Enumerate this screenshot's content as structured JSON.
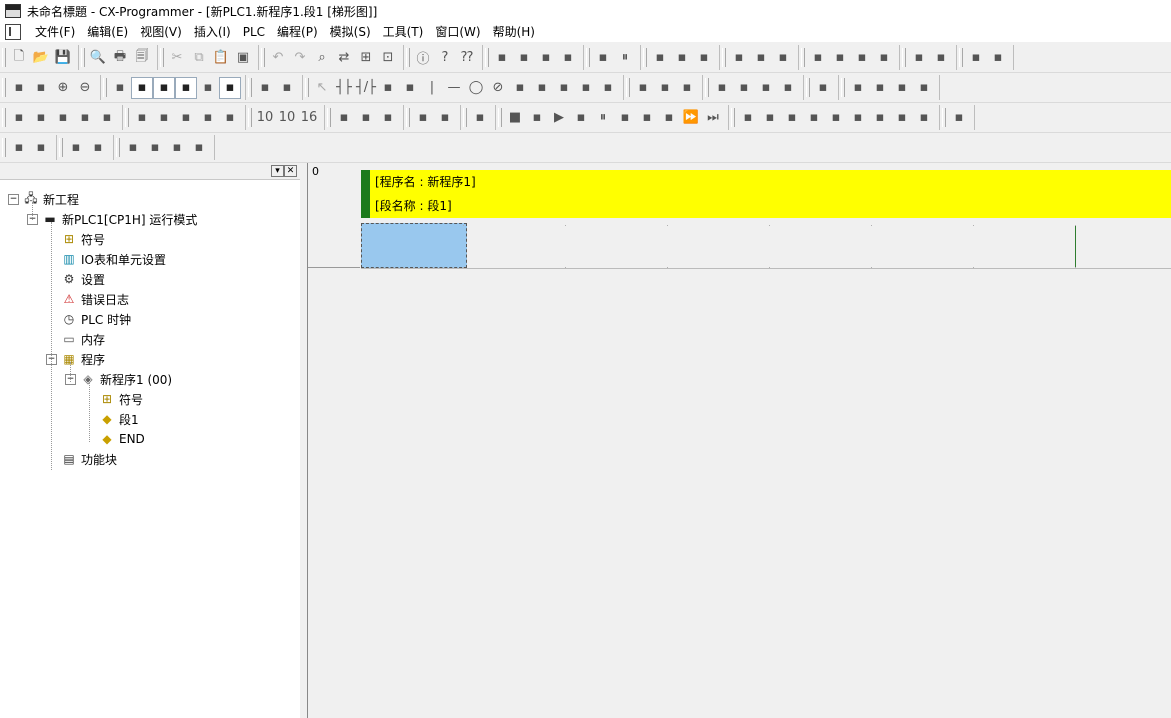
{
  "window": {
    "title": "未命名標題 - CX-Programmer - [新PLC1.新程序1.段1 [梯形图]]"
  },
  "menu": {
    "items": [
      "文件(F)",
      "编辑(E)",
      "视图(V)",
      "插入(I)",
      "PLC",
      "编程(P)",
      "模拟(S)",
      "工具(T)",
      "窗口(W)",
      "帮助(H)"
    ]
  },
  "toolbars": {
    "row1": [
      [
        "new-file-icon",
        "open-folder-icon",
        "save-icon"
      ],
      [
        "print-preview-icon",
        "print-icon",
        "print-setup-icon"
      ],
      [
        "cut-icon",
        "copy-icon",
        "paste-icon",
        "clipboard-icon"
      ],
      [
        "undo-icon",
        "redo-icon",
        "find-icon",
        "replace-icon",
        "cross-ref-icon",
        "address-icon"
      ],
      [
        "about-icon",
        "help-icon",
        "context-help-icon"
      ],
      [
        "work-online-icon",
        "transfer-icon",
        "find-net-icon",
        "plc-monitor-icon"
      ],
      [
        "toggle-bit-icon",
        "pause-icon"
      ],
      [
        "compare-icon",
        "upload-icon",
        "download-icon"
      ],
      [
        "online-edit-icon",
        "online-edit-send-icon",
        "online-edit-cancel-icon"
      ],
      [
        "mode-program-icon",
        "mode-debug-icon",
        "mode-monitor-icon",
        "mode-run-icon"
      ],
      [
        "force-on-icon",
        "force-off-icon"
      ],
      [
        "set-icon",
        "reset-icon"
      ]
    ],
    "row2": [
      [
        "zoom-fit-icon",
        "zoom-tool-icon",
        "zoom-in-icon",
        "zoom-out-icon"
      ],
      [
        "grid-icon",
        "symbol-comment-icon",
        "list-icon",
        "rung-annotation-icon",
        "cross-icon",
        "monitor-icon"
      ],
      [
        "sma-icon",
        "ci-icon"
      ],
      [
        "select-icon",
        "no-contact-icon",
        "nc-contact-icon",
        "or-contact-icon",
        "or-nc-contact-icon",
        "vertical-icon",
        "horizontal-icon",
        "coil-icon",
        "nc-coil-icon",
        "instruction-icon",
        "pulse-up-icon",
        "pulse-down-icon",
        "line-corner-icon",
        "line-delete-icon"
      ],
      [
        "fb-call-icon",
        "fb-define-icon",
        "fb-online-icon"
      ],
      [
        "fb-param-icon",
        "fb-param2-icon",
        "fb-param3-icon",
        "fb-param4-icon"
      ],
      [
        "section-icon"
      ],
      [
        "view-ladder-icon",
        "view-mnemonic-icon",
        "view-st-icon",
        "view-sfc-icon"
      ]
    ],
    "row3": [
      [
        "window-project-icon",
        "window-output-icon",
        "window-watch-icon",
        "window-address-icon",
        "window-properties-icon"
      ],
      [
        "io-table-icon",
        "settings-icon",
        "memory-icon",
        "clock-icon",
        "error-log-icon"
      ],
      [
        "bin-icon",
        "dec-icon",
        "hex-icon"
      ],
      [
        "transfer-from-icon",
        "transfer-to-icon",
        "verify-icon"
      ],
      [
        "sim-connect-icon",
        "sim-settings-icon"
      ],
      [
        "sim-online-icon"
      ],
      [
        "sim-stop-icon",
        "sim-step-icon",
        "sim-run-icon",
        "sim-stop2-icon",
        "sim-pause-icon",
        "sim-step-in-icon",
        "sim-step-out-icon",
        "sim-step-run-icon",
        "sim-continue-icon",
        "sim-end-icon"
      ],
      [
        "sim-io-icon",
        "sim-io2-icon",
        "sim-io3-icon",
        "sim-io4-icon",
        "sim-trigger-icon",
        "sim-trigger2-icon",
        "sim-trigger3-icon",
        "sim-trigger4-icon",
        "sim-trigger5-icon"
      ],
      [
        "sim-return-icon"
      ]
    ],
    "row4": [
      [
        "indent-decrease-icon",
        "indent-increase-icon"
      ],
      [
        "align-icon",
        "align2-icon"
      ],
      [
        "bookmark-icon",
        "bookmark-next-icon",
        "bookmark-prev-icon",
        "bookmark-clear-icon"
      ]
    ]
  },
  "tree": {
    "nodes": [
      {
        "id": "project",
        "label": "新工程",
        "icon": "network-icon",
        "level": 0,
        "expander": "−"
      },
      {
        "id": "plc",
        "label": "新PLC1[CP1H] 运行模式",
        "icon": "plc-icon",
        "level": 1,
        "expander": "−"
      },
      {
        "id": "symbols",
        "label": "符号",
        "icon": "symbols-icon",
        "level": 2
      },
      {
        "id": "io-table",
        "label": "IO表和单元设置",
        "icon": "io-table-icon",
        "level": 2
      },
      {
        "id": "settings",
        "label": "设置",
        "icon": "settings-icon",
        "level": 2
      },
      {
        "id": "error-log",
        "label": "错误日志",
        "icon": "error-log-icon",
        "level": 2
      },
      {
        "id": "plc-clock",
        "label": "PLC 时钟",
        "icon": "clock-icon",
        "level": 2
      },
      {
        "id": "memory",
        "label": "内存",
        "icon": "memory-icon",
        "level": 2
      },
      {
        "id": "programs",
        "label": "程序",
        "icon": "programs-icon",
        "level": 2,
        "expander": "−"
      },
      {
        "id": "new-program",
        "label": "新程序1 (00)",
        "icon": "program-icon",
        "level": 3,
        "expander": "−"
      },
      {
        "id": "local-symbols",
        "label": "符号",
        "icon": "symbols-icon",
        "level": 4
      },
      {
        "id": "section1",
        "label": "段1",
        "icon": "section-icon",
        "level": 4
      },
      {
        "id": "end",
        "label": "END",
        "icon": "section-icon",
        "level": 4
      },
      {
        "id": "function-blocks",
        "label": "功能块",
        "icon": "function-block-icon",
        "level": 2
      }
    ]
  },
  "ladder": {
    "rung_number": "0",
    "program_name_comment": "[程序名 : 新程序1]",
    "section_name_comment": "[段名称 : 段1]"
  },
  "colors": {
    "comment_background": "#ffff00",
    "comment_bar": "#1c7a1c",
    "cursor_cell": "#99c8ee",
    "right_rail": "#2f7d2f"
  }
}
